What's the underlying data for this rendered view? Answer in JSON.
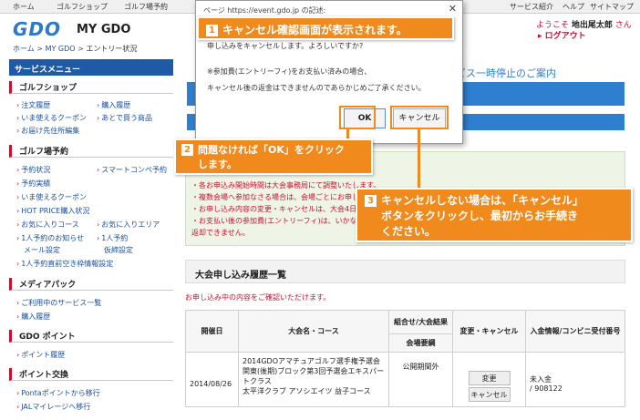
{
  "top_nav": {
    "left": [
      "ホーム",
      "ゴルフショップ",
      "ゴルフ場予約"
    ],
    "right": [
      "サービス紹介",
      "ヘルプ",
      "サイトマップ"
    ]
  },
  "header": {
    "logo": "GDO",
    "title": "MY GDO",
    "breadcrumb": [
      "ホーム",
      "MY GDO",
      "エントリー状況"
    ],
    "welcome_prefix": "ようこそ",
    "user_name": "地出尾太郎",
    "welcome_suffix": "さん",
    "logout": "ログアウト"
  },
  "sidebar": {
    "heading": "サービスメニュー",
    "sections": [
      {
        "title": "ゴルフショップ",
        "links": [
          "注文履歴",
          "購入履歴",
          "いま使えるクーポン",
          "あとで買う商品",
          "お届け先住所編集"
        ]
      },
      {
        "title": "ゴルフ場予約",
        "links": [
          "予約状況",
          "スマートコンペ予約",
          "予約実績",
          "いま使えるクーポン",
          "HOT PRICE購入状況",
          "お気に入りコース",
          "お気に入りエリア",
          "1人予約のお知らせ",
          "1人予約",
          "メール設定",
          "仮締設定",
          "1人予約直前空き枠情報設定"
        ]
      },
      {
        "title": "メディアパック",
        "links": [
          "ご利用中のサービス一覧",
          "購入履歴"
        ]
      },
      {
        "title": "GDO ポイント",
        "links": [
          "ポイント履歴"
        ]
      },
      {
        "title": "ポイント交換",
        "links": [
          "Pontaポイントから移行",
          "JALマイレージへ移行"
        ]
      }
    ]
  },
  "background": {
    "banner_text": "ビス一時停止のご案内",
    "notices": [
      "・各お申込み開始時間は大会事務局にて調整いたします。",
      "・複数会場へ参加なさる場合は、会場ごとにお申し込みください。",
      "・お申し込み内容の変更・キャンセルは、大会4日前まで可能です。",
      "・お支払い後の参加費(エントリーフィ)は、いかなる場合も",
      "返却できません。"
    ],
    "history_title": "大会申し込み履歴一覧",
    "history_subtitle": "お申し込み中の内容をご確認いただけます。",
    "table": {
      "headers": [
        "開催日",
        "大会名・コース",
        "組合せ/大会結果",
        "会場要綱",
        "変更・キャンセル",
        "入金情報/コンビニ受付番号"
      ],
      "row": {
        "date": "2014/08/26",
        "name": "2014GDOアマチュアゴルフ選手権予選会 関東(後期)ブロック第3回予選会エキスパートクラス",
        "course": "太平洋クラブ アソシエイツ 益子コース",
        "pairing": "公開期間外",
        "change": "変更",
        "cancel": "キャンセル",
        "payment": "未入金",
        "receipt": "/ 908122"
      }
    }
  },
  "dialog": {
    "title": "ページ https://event.gdo.jp の記述:",
    "message_lines": [
      "申し込みをキャンセルします。よろしいですか?",
      "※参加費(エントリーフィ)をお支払い済みの場合、",
      "キャンセル後の返金はできませんのであらかじめご了承ください。"
    ],
    "ok": "OK",
    "cancel": "キャンセル"
  },
  "callouts": [
    {
      "num": "1",
      "text": "キャンセル確認画面が表示されます。"
    },
    {
      "num": "2",
      "line1": "問題なければ「OK」をクリック",
      "line2": "します。"
    },
    {
      "num": "3",
      "line1": "キャンセルしない場合は、「キャンセル」",
      "line2": "ボタンをクリックし、最初からお手続き",
      "line3": "ください。"
    }
  ],
  "colors": {
    "accent": "#f08a1c",
    "brand_blue": "#2f77c9",
    "link": "#1a4fa0",
    "alert_red": "#c8102e"
  }
}
